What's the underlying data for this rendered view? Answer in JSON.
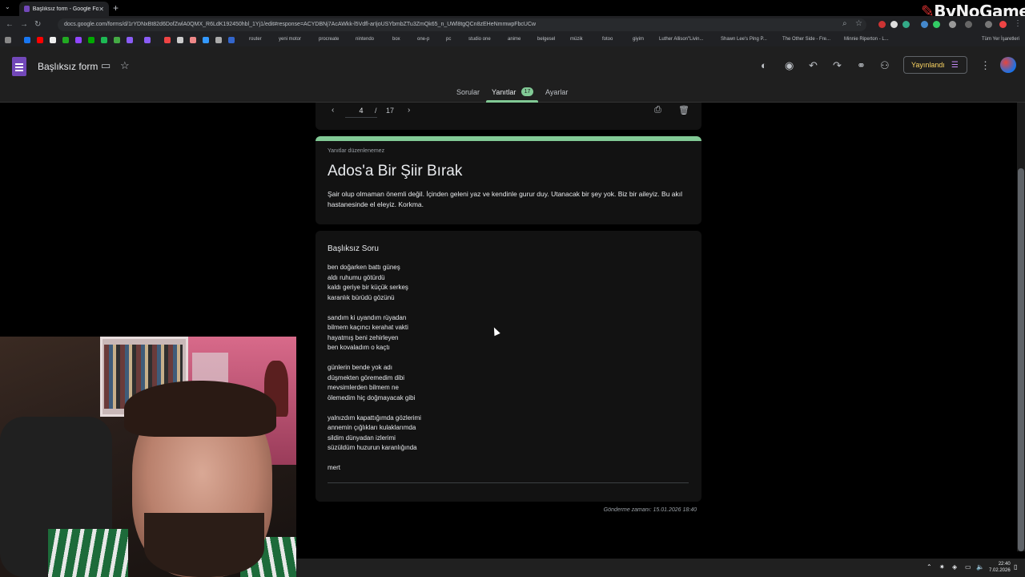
{
  "browser": {
    "tab_title": "Başlıksız form - Google Formlar",
    "url": "docs.google.com/forms/d/1rYDNxBt82d6DofZwlA0QMX_R6LdK192450hbl_1Yj1/edit#response=ACYDBNj7AcAWkk-l5Vdfl-arIjoUSYbmbZTu3ZmQk65_n_UWl8tgQCn8zEHeNmmwpFbcUCw",
    "bookmarks": [
      "router",
      "yeni motor",
      "procreate",
      "nintendo",
      "box",
      "one-p",
      "pc",
      "studio one",
      "anime",
      "belgesel",
      "müzik",
      "fotoo",
      "giyim",
      "Luther Allison\"Livin...",
      "Shawn Lee's Ping P...",
      "The Other Side - Fre...",
      "Minnie Riperton - L...",
      "Tüm Yer İşaretleri"
    ]
  },
  "forms_header": {
    "title": "Başlıksız form",
    "publish_label": "Yayınlandı",
    "tabs": [
      "Sorular",
      "Yanıtlar",
      "Ayarlar"
    ],
    "responses_badge": "17"
  },
  "response_nav": {
    "current": "4",
    "separator": "/",
    "total": "17"
  },
  "form_header_card": {
    "notice": "Yanıtlar düzenlenemez",
    "title": "Ados'a Bir Şiir Bırak",
    "description": "Şair olup olmaman önemli değil. İçinden geleni yaz ve kendinle gurur duy. Utanacak bir şey yok. Biz bir aileyiz. Bu akıl hastanesinde el eleyiz. Korkma."
  },
  "answer_card": {
    "question": "Başlıksız Soru",
    "answer": "ben doğarken battı güneş\naldı ruhumu götürdü\nkaldı geriye bir küçük serkeş\nkaranlık bürüdü gözünü\n\nsandım ki uyandım rüyadan\nbilmem kaçıncı kerahat vakti\nhayatmış beni zehirleyen\nben kovaladım o kaçtı\n\ngünlerin bende yok adı\ndüşmekten göremedim dibi\nmevsimlerden bilmem ne\nölemedim hiç doğmayacak gibi\n\nyalnızdım kapattığımda gözlerimi\nannemin çığlıkları kulaklarımda\nsildim dünyadan izlerimi\nsüzüldüm huzurun karanlığında\n\nmert"
  },
  "submitted": "Gönderme zamanı: 15.01.2026 18:40",
  "taskbar": {
    "time": "22:40",
    "date": "7.02.2026"
  },
  "watermark": "ByNoGame",
  "colors": {
    "accent_green": "#81c995",
    "publish_yellow": "#fdd663",
    "forms_purple": "#7248b9"
  }
}
